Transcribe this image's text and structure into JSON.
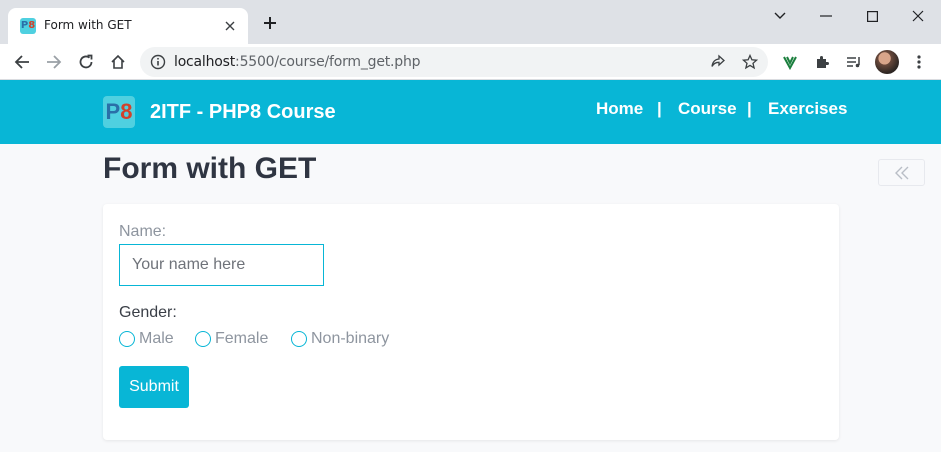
{
  "browser": {
    "tab_title": "Form with GET",
    "url_host": "localhost",
    "url_rest": ":5500/course/form_get.php"
  },
  "site": {
    "logo_p": "P",
    "logo_8": "8",
    "brand": "2ITF - PHP8 Course",
    "nav": [
      {
        "label": "Home"
      },
      {
        "label": "Course"
      },
      {
        "label": "Exercises"
      }
    ],
    "nav_separator": "|"
  },
  "page": {
    "title": "Form with GET"
  },
  "form": {
    "name_label": "Name:",
    "name_value": "",
    "name_placeholder": "Your name here",
    "gender_label": "Gender:",
    "gender_options": [
      {
        "label": "Male"
      },
      {
        "label": "Female"
      },
      {
        "label": "Non-binary"
      }
    ],
    "submit_label": "Submit"
  },
  "colors": {
    "accent": "#08b6d6",
    "heading": "#2f3542",
    "muted_text": "#8e959f"
  }
}
